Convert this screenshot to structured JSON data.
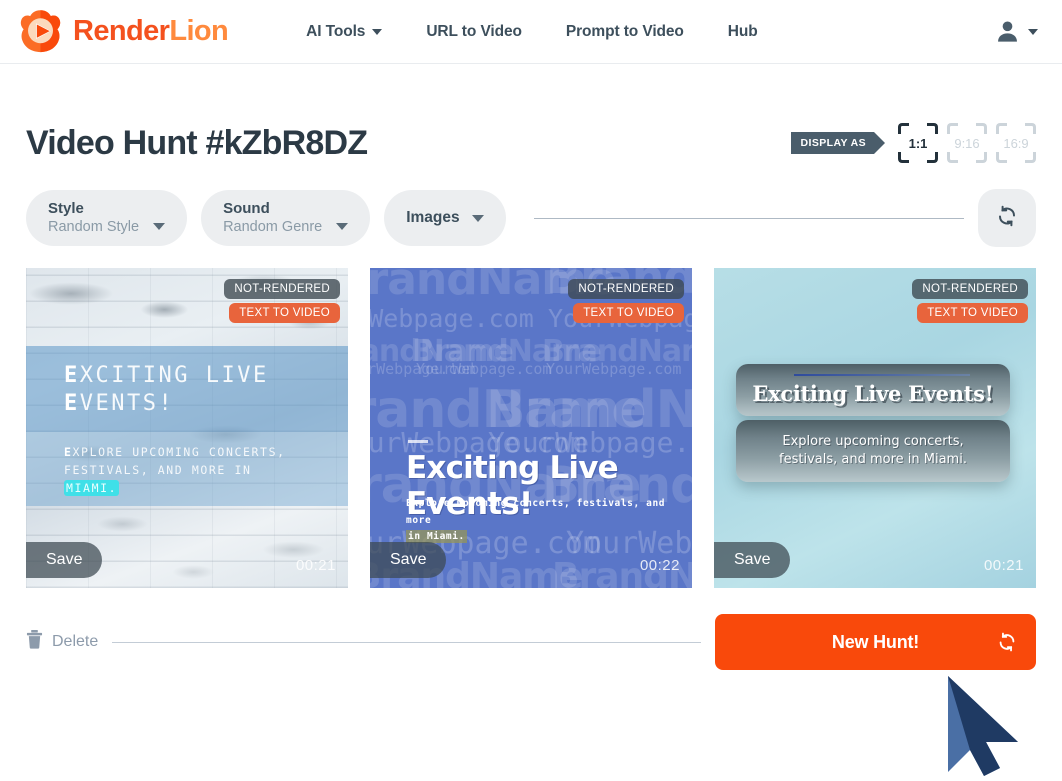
{
  "header": {
    "brand": {
      "first": "Render",
      "second": "Lion",
      "logo_icon": "lion-play-logo"
    },
    "nav": [
      {
        "label": "AI Tools",
        "has_caret": true
      },
      {
        "label": "URL to Video",
        "has_caret": false
      },
      {
        "label": "Prompt to Video",
        "has_caret": false
      },
      {
        "label": "Hub",
        "has_caret": false
      }
    ],
    "account": {
      "icon": "person-icon",
      "caret_icon": "chevron-down-icon"
    }
  },
  "page": {
    "title": "Video Hunt #kZbR8DZ",
    "display_as": {
      "label": "DISPLAY AS",
      "options": [
        {
          "label": "1:1",
          "selected": true
        },
        {
          "label": "9:16",
          "selected": false
        },
        {
          "label": "16:9",
          "selected": false
        }
      ]
    },
    "filters": [
      {
        "label": "Style",
        "value": "Random Style",
        "icon": "chevron-down-icon"
      },
      {
        "label": "Sound",
        "value": "Random Genre",
        "icon": "chevron-down-icon"
      },
      {
        "label": "Images",
        "value": "",
        "icon": "chevron-down-icon"
      }
    ],
    "refresh_button": {
      "icon": "refresh-icon"
    }
  },
  "cards": [
    {
      "state_badge": "NOT-RENDERED",
      "type_badge": "TEXT TO VIDEO",
      "headline_line1": "XCITING LIVE",
      "headline_line2": "VENTS!",
      "headline_cap": "E",
      "body_line1": "XPLORE UPCOMING CONCERTS,",
      "body_line2": "FESTIVALS, AND MORE IN",
      "body_line3": "MIAMI.",
      "body_cap": "E",
      "save_label": "Save",
      "duration": "00:21",
      "style": "brick"
    },
    {
      "state_badge": "NOT-RENDERED",
      "type_badge": "TEXT TO VIDEO",
      "headline": "Exciting Live Events!",
      "body_line1": "Explore upcoming concerts, festivals, and more",
      "body_line2": "in Miami.",
      "save_label": "Save",
      "duration": "00:22",
      "style": "watermark",
      "watermark_brand": "BrandName",
      "watermark_url": "YourWebpage.com"
    },
    {
      "state_badge": "NOT-RENDERED",
      "type_badge": "TEXT TO VIDEO",
      "headline": "Exciting Live Events!",
      "body_line1": "Explore upcoming concerts,",
      "body_line2": "festivals, and more in Miami.",
      "save_label": "Save",
      "duration": "00:21",
      "style": "teal"
    }
  ],
  "footer": {
    "delete_label": "Delete",
    "delete_icon": "trash-icon",
    "new_hunt_label": "New Hunt!",
    "new_hunt_icon": "refresh-icon"
  },
  "colors": {
    "brand_orange": "#f4511e",
    "brand_orange_light": "#ff8a3d",
    "cta_orange": "#f9490b",
    "badge_orange": "#e8643c",
    "ink": "#2c3a45",
    "muted": "#8a9aa6",
    "pill_bg": "#eceef0",
    "cursor_blue": "#4a6fa5",
    "cursor_navy": "#1f3a63"
  },
  "cursor": {
    "icon": "mouse-pointer-icon"
  }
}
